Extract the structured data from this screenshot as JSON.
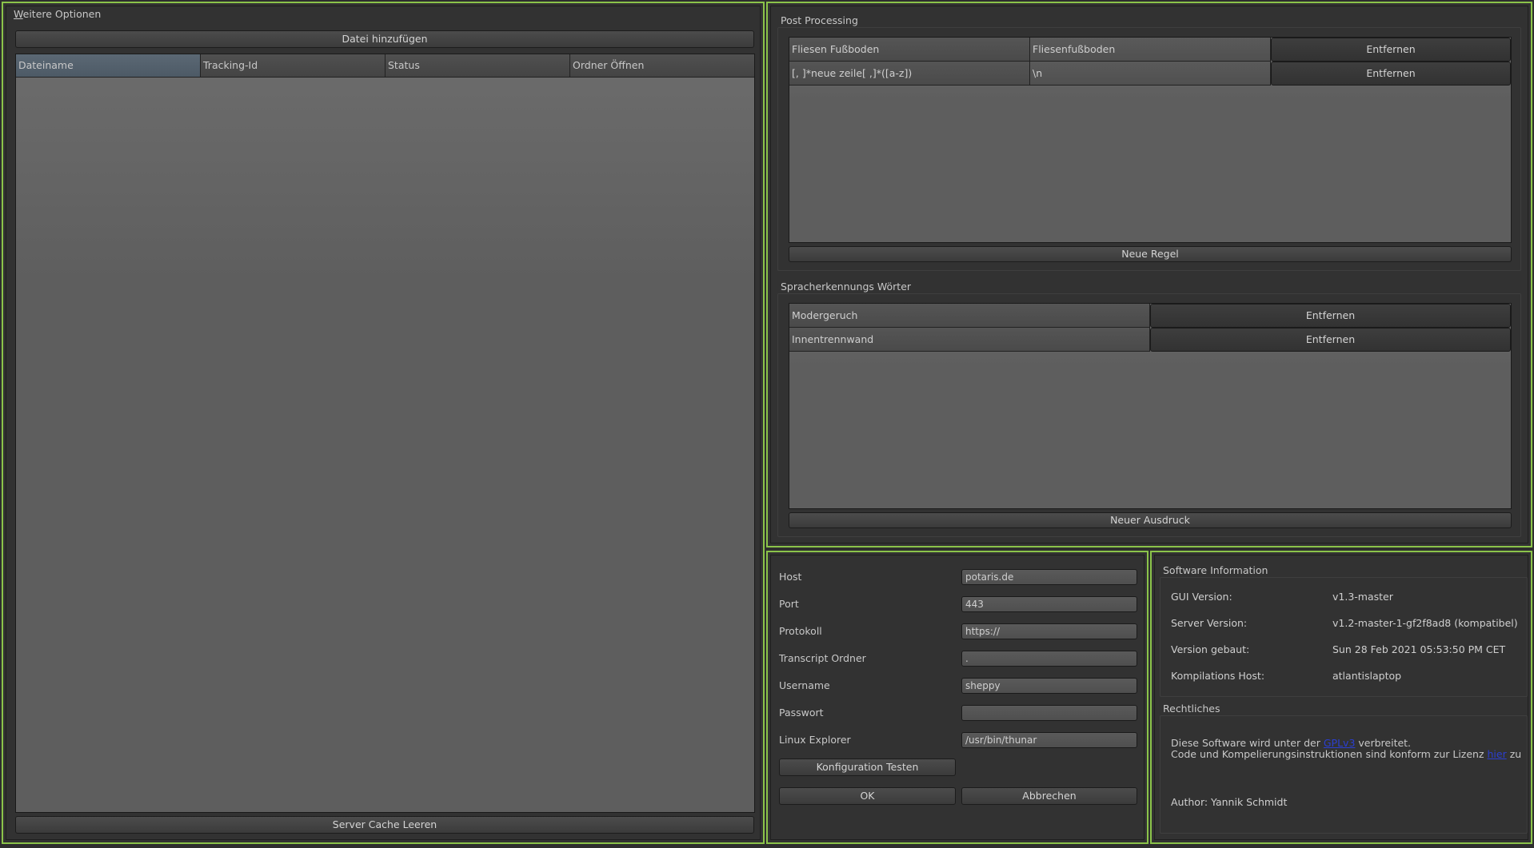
{
  "left_panel": {
    "title_mnemonic": "W",
    "title_rest": "eitere Optionen",
    "add_file_button": "Datei hinzufügen",
    "columns": [
      "Dateiname",
      "Tracking-Id",
      "Status",
      "Ordner Öffnen"
    ],
    "clear_cache_button": "Server Cache Leeren"
  },
  "post_processing": {
    "title": "Post Processing",
    "rules": [
      {
        "pattern": "Fliesen Fußboden",
        "replacement": "Fliesenfußboden",
        "remove_label": "Entfernen"
      },
      {
        "pattern": "[, ]*neue zeile[ ,]*([a-z])",
        "replacement": "\\n",
        "remove_label": "Entfernen"
      }
    ],
    "new_rule_button": "Neue Regel"
  },
  "speech_words": {
    "title": "Spracherkennungs Wörter",
    "words": [
      {
        "word": "Modergeruch",
        "remove_label": "Entfernen"
      },
      {
        "word": "Innentrennwand",
        "remove_label": "Entfernen"
      }
    ],
    "new_expression_button": "Neuer Ausdruck"
  },
  "config": {
    "fields": [
      {
        "label": "Host",
        "value": "potaris.de"
      },
      {
        "label": "Port",
        "value": "443"
      },
      {
        "label": "Protokoll",
        "value": "https://"
      },
      {
        "label": "Transcript Ordner",
        "value": "."
      },
      {
        "label": "Username",
        "value": "sheppy"
      },
      {
        "label": "Passwort",
        "value": ""
      },
      {
        "label": "Linux Explorer",
        "value": "/usr/bin/thunar"
      }
    ],
    "test_button": "Konfiguration Testen",
    "ok_button": "OK",
    "cancel_button": "Abbrechen"
  },
  "software_info": {
    "title": "Software Information",
    "rows": [
      {
        "label": "GUI Version:",
        "value": "v1.3-master"
      },
      {
        "label": "Server Version:",
        "value": "v1.2-master-1-gf2f8ad8 (kompatibel)"
      },
      {
        "label": "Version gebaut:",
        "value": "Sun 28 Feb 2021 05:53:50 PM CET"
      },
      {
        "label": "Kompilations Host:",
        "value": "atlantislaptop"
      }
    ],
    "legal_title": "Rechtliches",
    "legal_line1_pre": "Diese Software wird unter der ",
    "legal_line1_link": "GPLv3",
    "legal_line1_post": " verbreitet.",
    "legal_line2_pre": "Code und Kompelierungsinstruktionen sind konform zur Lizenz ",
    "legal_line2_link": "hier",
    "legal_line2_post": " zug",
    "author": "Author: Yannik Schmidt"
  }
}
